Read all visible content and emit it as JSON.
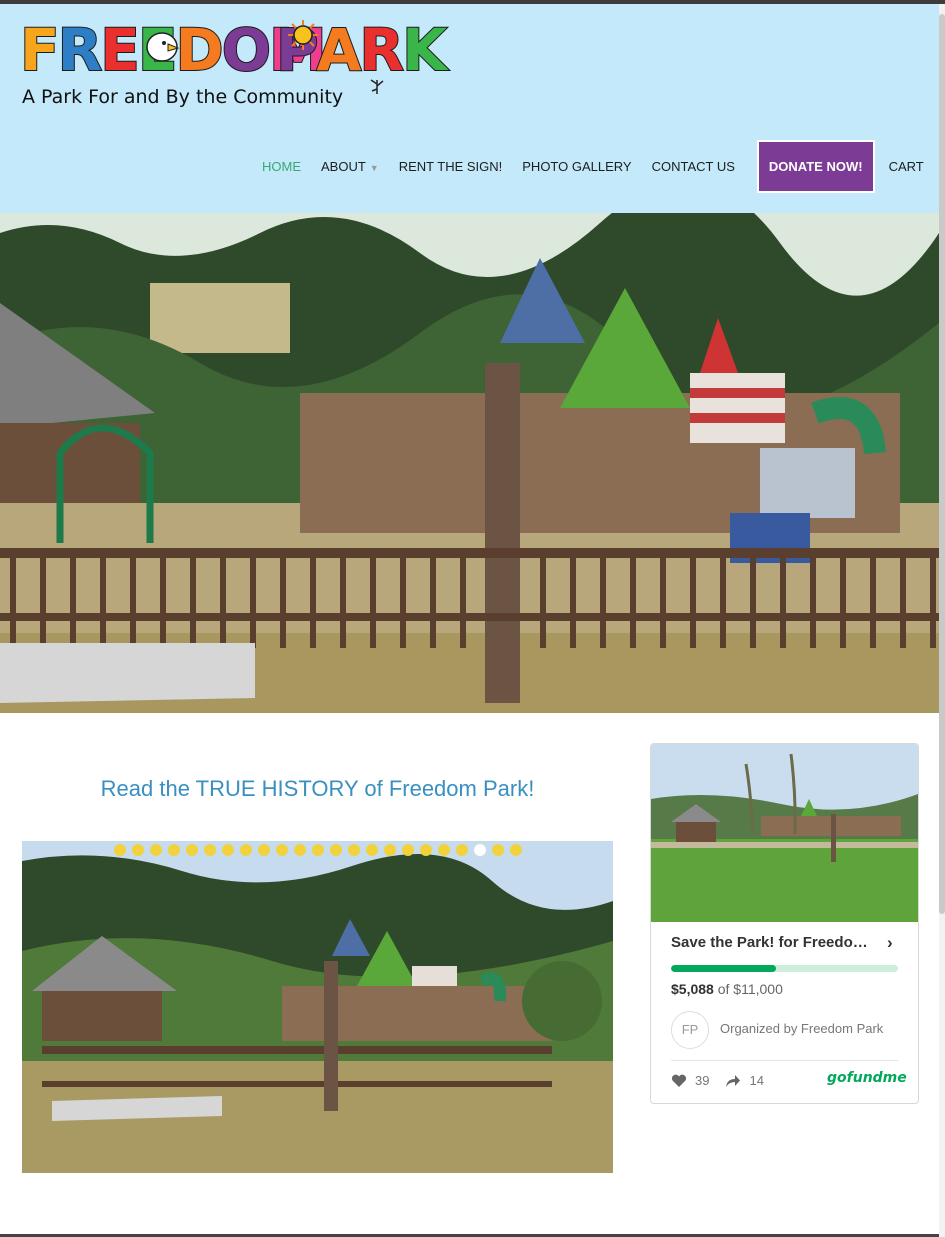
{
  "logo": {
    "word1": [
      "F",
      "R",
      "E",
      "E",
      "D",
      "O",
      "M"
    ],
    "word1_colors": [
      "#f7a51d",
      "#2d7ec4",
      "#e9302f",
      "#39b54a",
      "#f47b20",
      "#7c3c95",
      "#ef3e8f"
    ],
    "word2": [
      "P",
      "A",
      "R",
      "K"
    ],
    "word2_colors": [
      "#7c3c95",
      "#f47b20",
      "#e9302f",
      "#39b54a"
    ],
    "tagline": "A Park For and By the Community"
  },
  "nav": {
    "home": "HOME",
    "about": "ABOUT",
    "rent": "RENT THE SIGN!",
    "gallery": "PHOTO GALLERY",
    "contact": "CONTACT US",
    "donate": "DONATE NOW!",
    "cart": "CART"
  },
  "main": {
    "history_link": "Read the TRUE HISTORY of Freedom Park!",
    "slider_dot_count": 23,
    "slider_active_dot": 20
  },
  "gofundme": {
    "title": "Save the Park! for Freedom Park",
    "raised": "$5,088",
    "of_text": "of",
    "goal": "$11,000",
    "progress_fraction": 0.4625,
    "initials": "FP",
    "organizer": "Organized by Freedom Park",
    "hearts": "39",
    "shares": "14",
    "brand": "gofundme"
  },
  "colors": {
    "header_bg": "#c4e9fa",
    "nav_active": "#3aa971",
    "donate_bg": "#7c3c95",
    "link": "#3a8fc1",
    "gfm_green": "#02a95c"
  }
}
